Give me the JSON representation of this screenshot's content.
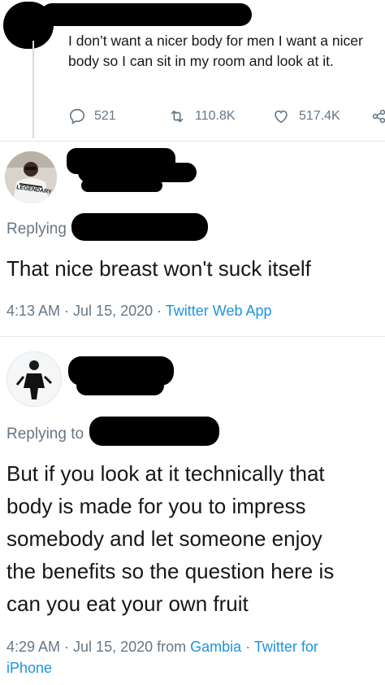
{
  "tweet1": {
    "text": "I don’t want a nicer body for men I want a nicer body so I can sit in my room and look at it.",
    "replies": "521",
    "retweets": "110.8K",
    "likes": "517.4K"
  },
  "reply1": {
    "avatar_shirt_text": "LEGENDARY",
    "replying_label": "Replying t",
    "text": "That nice breast won't suck itself",
    "time": "4:13 AM",
    "date": "Jul 15, 2020",
    "client": "Twitter Web App"
  },
  "reply2": {
    "replying_label": "Replying to",
    "lines": [
      "But if you look at it technically that",
      "body is made for you to impress",
      "somebody and let someone enjoy",
      "the benefits so the question here is",
      "can you eat your own fruit"
    ],
    "time": "4:29 AM",
    "date": "Jul 15, 2020",
    "from_label": "from",
    "location": "Gambia",
    "client_line1": "Twitter for",
    "client_line2": "iPhone"
  },
  "colors": {
    "text": "#14171a",
    "muted": "#657786",
    "link": "#1b95e0",
    "divider": "#e1e8ed"
  },
  "icons": [
    "reply-icon",
    "retweet-icon",
    "like-icon",
    "share-icon"
  ]
}
